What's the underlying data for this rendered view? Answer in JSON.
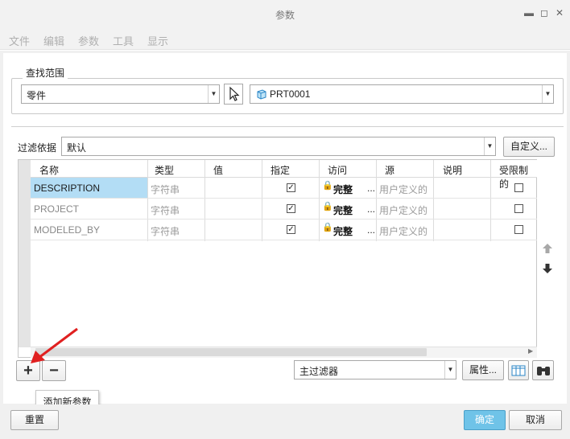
{
  "window": {
    "title": "参数",
    "controls": {
      "minimize": "▬",
      "maximize": "◻",
      "close": "✕"
    }
  },
  "menu": {
    "items": [
      "文件",
      "编辑",
      "参数",
      "工具",
      "显示"
    ]
  },
  "scope": {
    "label": "查找范围",
    "type_value": "零件",
    "object_value": "PRT0001"
  },
  "filter": {
    "label": "过滤依据",
    "value": "默认",
    "customize_label": "自定义..."
  },
  "table": {
    "columns": [
      "名称",
      "类型",
      "值",
      "指定",
      "访问",
      "源",
      "说明",
      "受限制的"
    ],
    "rows": [
      {
        "name": "DESCRIPTION",
        "type": "字符串",
        "value": "",
        "designated": true,
        "access": "完整",
        "source": "用户定义的",
        "description": "",
        "restricted": false,
        "selected": true
      },
      {
        "name": "PROJECT",
        "type": "字符串",
        "value": "",
        "designated": true,
        "access": "完整",
        "source": "用户定义的",
        "description": "",
        "restricted": false,
        "selected": false
      },
      {
        "name": "MODELED_BY",
        "type": "字符串",
        "value": "",
        "designated": true,
        "access": "完整",
        "source": "用户定义的",
        "description": "",
        "restricted": false,
        "selected": false
      }
    ],
    "ellipsis": "..."
  },
  "toolbar": {
    "add_label": "+",
    "remove_label": "−",
    "main_filter_value": "主过滤器",
    "properties_label": "属性..."
  },
  "tooltip": {
    "text": "添加新参数"
  },
  "footer": {
    "reset_label": "重置",
    "ok_label": "确定",
    "cancel_label": "取消"
  },
  "colors": {
    "selection": "#b3ddf5",
    "ok_button": "#6fc3e8",
    "arrow_red": "#e02020"
  }
}
